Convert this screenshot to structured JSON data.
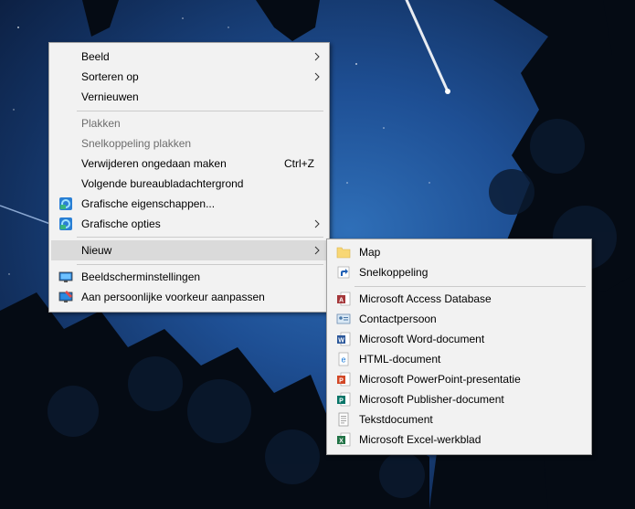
{
  "main_menu": {
    "items": [
      {
        "label": "Beeld",
        "submenu": true
      },
      {
        "label": "Sorteren op",
        "submenu": true
      },
      {
        "label": "Vernieuwen"
      },
      {
        "label": "Plakken",
        "disabled": true
      },
      {
        "label": "Snelkoppeling plakken",
        "disabled": true
      },
      {
        "label": "Verwijderen ongedaan maken",
        "shortcut": "Ctrl+Z"
      },
      {
        "label": "Volgende bureaubladachtergrond"
      },
      {
        "label": "Grafische eigenschappen...",
        "icon": "graphics-icon"
      },
      {
        "label": "Grafische opties",
        "icon": "graphics-icon",
        "submenu": true
      },
      {
        "label": "Nieuw",
        "submenu": true,
        "highlighted": true
      },
      {
        "label": "Beeldscherminstellingen",
        "icon": "display-icon"
      },
      {
        "label": "Aan persoonlijke voorkeur aanpassen",
        "icon": "personalize-icon"
      }
    ]
  },
  "sub_menu": {
    "items": [
      {
        "label": "Map",
        "icon": "folder-icon"
      },
      {
        "label": "Snelkoppeling",
        "icon": "shortcut-icon"
      },
      {
        "label": "Microsoft Access Database",
        "icon": "access-icon"
      },
      {
        "label": "Contactpersoon",
        "icon": "contact-icon"
      },
      {
        "label": "Microsoft Word-document",
        "icon": "word-icon"
      },
      {
        "label": "HTML-document",
        "icon": "html-icon"
      },
      {
        "label": "Microsoft PowerPoint-presentatie",
        "icon": "powerpoint-icon"
      },
      {
        "label": "Microsoft Publisher-document",
        "icon": "publisher-icon"
      },
      {
        "label": "Tekstdocument",
        "icon": "text-document-icon"
      },
      {
        "label": "Microsoft Excel-werkblad",
        "icon": "excel-icon"
      }
    ]
  },
  "colors": {
    "menu_bg": "#f2f2f2",
    "highlight": "#dadada",
    "disabled_text": "#6d6d6d",
    "access": "#a4373a",
    "word": "#2b579a",
    "powerpoint": "#d24726",
    "publisher": "#077568",
    "excel": "#217346",
    "folder": "#f8d775"
  }
}
